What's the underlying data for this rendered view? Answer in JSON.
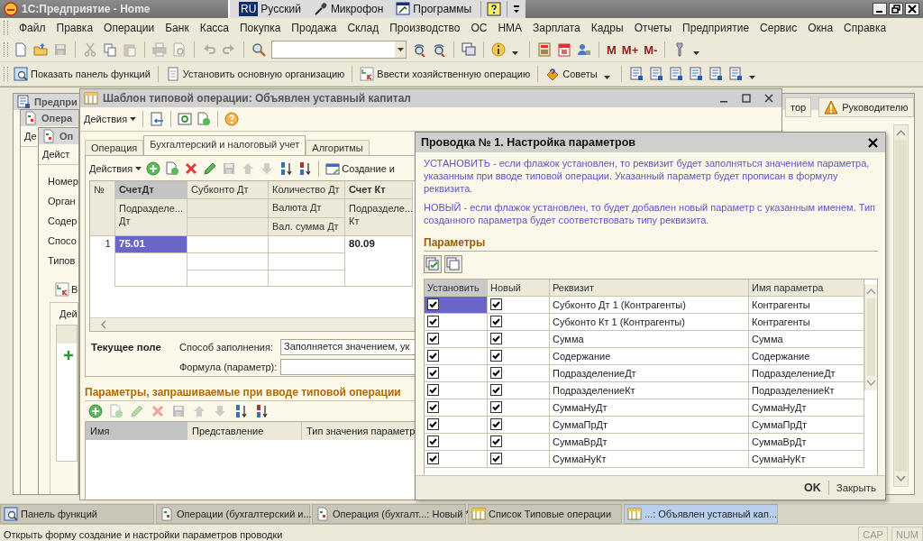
{
  "app": {
    "title": "1С:Предприятие - Home"
  },
  "language_bar": [
    {
      "kind": "lang",
      "code": "RU",
      "label": "Русский"
    },
    {
      "kind": "mic",
      "label": "Микрофон"
    },
    {
      "kind": "programs",
      "label": "Программы"
    },
    {
      "kind": "help"
    }
  ],
  "menu": [
    "Файл",
    "Правка",
    "Операции",
    "Банк",
    "Касса",
    "Покупка",
    "Продажа",
    "Склад",
    "Производство",
    "ОС",
    "НМА",
    "Зарплата",
    "Кадры",
    "Отчеты",
    "Предприятие",
    "Сервис",
    "Окна",
    "Справка"
  ],
  "memory_buttons": [
    "M",
    "M+",
    "M-"
  ],
  "quick_toolbar": [
    {
      "label": "Показать панель функций"
    },
    {
      "label": "Установить основную организацию"
    },
    {
      "label": "Ввести хозяйственную операцию"
    },
    {
      "label": "Советы"
    }
  ],
  "back_windows": {
    "main": {
      "title": "Предпри",
      "tabs": [
        {
          "label": "тор"
        },
        {
          "label": "Руководителю"
        }
      ]
    },
    "second": {
      "title": "Опера",
      "actions": "Де"
    },
    "third": {
      "title": "Оп",
      "actions": "Дейст",
      "fields": [
        "Номер",
        "Орган",
        "Содер",
        "Спосо",
        "Типов"
      ],
      "tab": "В",
      "tab_actions": "Дей"
    }
  },
  "template_window": {
    "title": "Шаблон типовой операции: Объявлен уставный капитал",
    "actions": "Действия",
    "tabs": [
      {
        "label": "Операция",
        "selected": false
      },
      {
        "label": "Бухгалтерский и налоговый учет",
        "selected": true
      },
      {
        "label": "Алгоритмы",
        "selected": false
      }
    ],
    "entries": {
      "actions": "Действия",
      "create": "Создание и",
      "header": {
        "number": "№",
        "debit_account": "СчетДт",
        "debit_subconto": "Субконто Дт",
        "debit_quantity": "Количество Дт",
        "credit_account": "Счет Кт",
        "debit_department": "Подразделе... Дт",
        "debit_currency": "Валюта Дт",
        "debit_currency_sum": "Вал. сумма Дт",
        "credit_department": "Подразделе... Кт"
      },
      "rows": [
        {
          "number": "1",
          "debit_account": "75.01",
          "credit_account": "80.09",
          "selected": true
        }
      ]
    },
    "current_field": {
      "heading": "Текущее поле",
      "fill_label": "Способ заполнения:",
      "fill_value": "Заполняется значением, ук",
      "formula_label": "Формула (параметр):"
    },
    "parameters": {
      "heading": "Параметры, запрашиваемые при вводе типовой операции",
      "columns": [
        {
          "label": "Имя",
          "selected": true
        },
        {
          "label": "Представление",
          "selected": false
        },
        {
          "label": "Тип значения параметр",
          "selected": false
        }
      ]
    }
  },
  "dialog": {
    "title": "Проводка № 1. Настройка параметров",
    "notes": [
      "УСТАНОВИТЬ - если флажок установлен, то реквизит будет заполняться значением параметра, указанным при вводе типовой операции. Указанный параметр будет прописан в формулу реквизита.",
      "НОВЫЙ - если флажок установлен, то будет добавлен новый параметр с указанным именем. Тип созданного параметра будет соответствовать типу реквизита."
    ],
    "heading": "Параметры",
    "columns": [
      {
        "label": "Установить",
        "selected": true
      },
      {
        "label": "Новый",
        "selected": false
      },
      {
        "label": "Реквизит",
        "selected": false
      },
      {
        "label": "Имя параметра",
        "selected": false
      }
    ],
    "rows": [
      {
        "set": true,
        "new": true,
        "attribute": "Субконто Дт 1 (Контрагенты)",
        "parameter": "Контрагенты",
        "selected": true
      },
      {
        "set": true,
        "new": true,
        "attribute": "Субконто Кт 1 (Контрагенты)",
        "parameter": "Контрагенты",
        "selected": false
      },
      {
        "set": true,
        "new": true,
        "attribute": "Сумма",
        "parameter": "Сумма",
        "selected": false
      },
      {
        "set": true,
        "new": true,
        "attribute": "Содержание",
        "parameter": "Содержание",
        "selected": false
      },
      {
        "set": true,
        "new": true,
        "attribute": "ПодразделениеДт",
        "parameter": "ПодразделениеДт",
        "selected": false
      },
      {
        "set": true,
        "new": true,
        "attribute": "ПодразделениеКт",
        "parameter": "ПодразделениеКт",
        "selected": false
      },
      {
        "set": true,
        "new": true,
        "attribute": "СуммаНуДт",
        "parameter": "СуммаНуДт",
        "selected": false
      },
      {
        "set": true,
        "new": true,
        "attribute": "СуммаПрДт",
        "parameter": "СуммаПрДт",
        "selected": false
      },
      {
        "set": true,
        "new": true,
        "attribute": "СуммаВрДт",
        "parameter": "СуммаВрДт",
        "selected": false
      },
      {
        "set": true,
        "new": true,
        "attribute": "СуммаНуКт",
        "parameter": "СуммаНуКт",
        "selected": false
      }
    ],
    "buttons": [
      {
        "label": "OK",
        "default": true
      },
      {
        "label": "Закрыть",
        "default": false
      }
    ]
  },
  "taskbar": [
    {
      "kind": "functions",
      "label": "Панель функций",
      "selected": false
    },
    {
      "kind": "document",
      "label": "Операции (бухгалтерский и...",
      "selected": false
    },
    {
      "kind": "document",
      "label": "Операция (бухгалт...: Новый *",
      "selected": false
    },
    {
      "kind": "list",
      "label": "Список Типовые операции",
      "selected": false
    },
    {
      "kind": "list",
      "label": "...: Объявлен уставный кап...",
      "selected": true
    }
  ],
  "status_bar": {
    "text": "Открыть форму создание и настройки параметров проводки",
    "indicators": [
      "CAP",
      "NUM"
    ]
  }
}
